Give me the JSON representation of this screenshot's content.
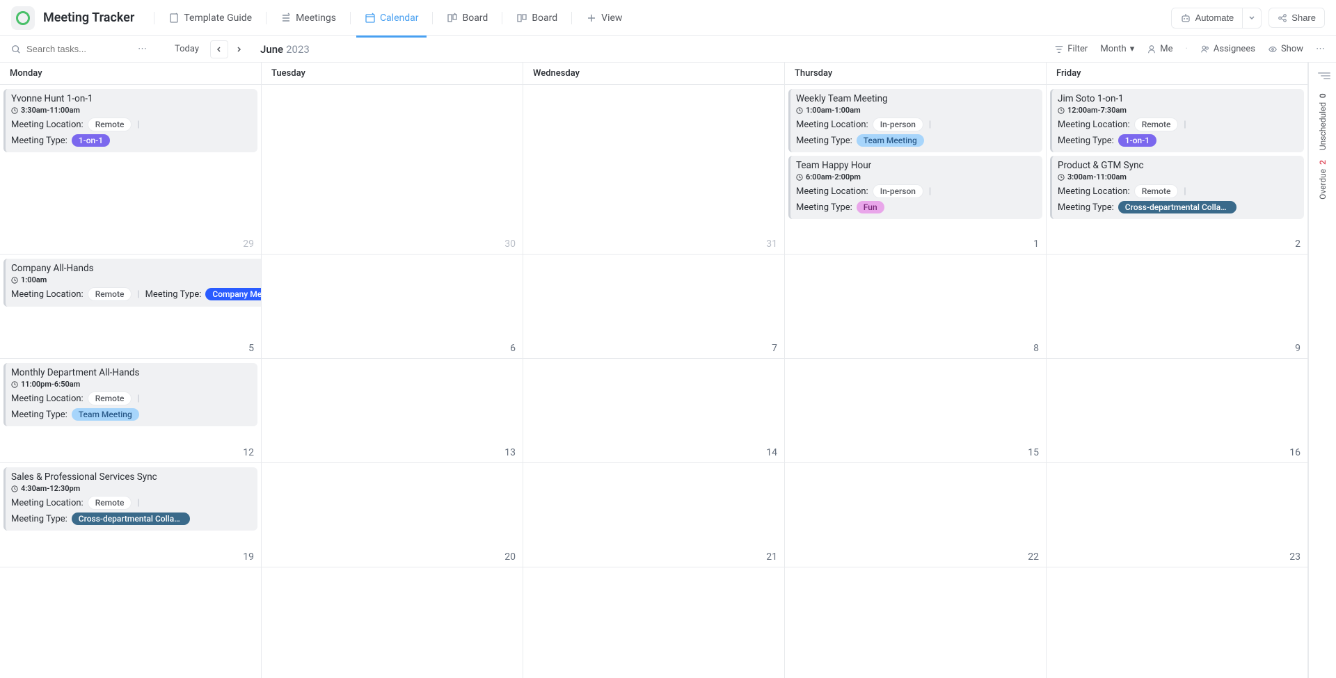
{
  "header": {
    "title": "Meeting Tracker",
    "tabs": [
      "Template Guide",
      "Meetings",
      "Calendar",
      "Board",
      "Board"
    ],
    "view": "View",
    "automate": "Automate",
    "share": "Share"
  },
  "controls": {
    "search_placeholder": "Search tasks...",
    "today": "Today",
    "month": "June",
    "year": "2023",
    "filter": "Filter",
    "view_mode": "Month",
    "me": "Me",
    "assignees": "Assignees",
    "show": "Show"
  },
  "day_headers": [
    "Monday",
    "Tuesday",
    "Wednesday",
    "Thursday",
    "Friday"
  ],
  "grid_days": [
    [
      {
        "n": "29",
        "muted": true
      },
      {
        "n": "30",
        "muted": true
      },
      {
        "n": "31",
        "muted": true
      },
      {
        "n": "1"
      },
      {
        "n": "2"
      }
    ],
    [
      {
        "n": "5"
      },
      {
        "n": "6"
      },
      {
        "n": "7"
      },
      {
        "n": "8"
      },
      {
        "n": "9"
      }
    ],
    [
      {
        "n": "12"
      },
      {
        "n": "13"
      },
      {
        "n": "14"
      },
      {
        "n": "15"
      },
      {
        "n": "16"
      }
    ],
    [
      {
        "n": "19"
      },
      {
        "n": "20"
      },
      {
        "n": "21"
      },
      {
        "n": "22"
      },
      {
        "n": "23"
      }
    ],
    [
      {
        "n": ""
      },
      {
        "n": ""
      },
      {
        "n": ""
      },
      {
        "n": ""
      },
      {
        "n": ""
      }
    ]
  ],
  "labels": {
    "location": "Meeting Location:",
    "type": "Meeting Type:"
  },
  "events": {
    "r0c0": [
      {
        "title": "Yvonne Hunt 1-on-1",
        "time": "3:30am-11:00am",
        "loc": "Remote",
        "loc_cls": "remote",
        "mtype": "1-on-1",
        "mtype_cls": "one"
      }
    ],
    "r0c3": [
      {
        "title": "Weekly Team Meeting",
        "time": "1:00am-1:00am",
        "loc": "In-person",
        "loc_cls": "inperson",
        "mtype": "Team Meeting",
        "mtype_cls": "team"
      },
      {
        "title": "Team Happy Hour",
        "time": "6:00am-2:00pm",
        "loc": "In-person",
        "loc_cls": "inperson",
        "mtype": "Fun",
        "mtype_cls": "fun"
      }
    ],
    "r0c4": [
      {
        "title": "Jim Soto 1-on-1",
        "time": "12:00am-7:30am",
        "loc": "Remote",
        "loc_cls": "remote",
        "mtype": "1-on-1",
        "mtype_cls": "one"
      },
      {
        "title": "Product & GTM Sync",
        "time": "3:00am-11:00am",
        "loc": "Remote",
        "loc_cls": "remote",
        "mtype": "Cross-departmental Collab…",
        "mtype_cls": "cross"
      }
    ],
    "r1c0": [
      {
        "title": "Company All-Hands",
        "time": "1:00am",
        "loc": "Remote",
        "loc_cls": "remote",
        "mtype": "Company Meeting",
        "mtype_cls": "company",
        "wide": true
      }
    ],
    "r2c0": [
      {
        "title": "Monthly Department All-Hands",
        "time": "11:00pm-6:50am",
        "loc": "Remote",
        "loc_cls": "remote",
        "mtype": "Team Meeting",
        "mtype_cls": "team"
      }
    ],
    "r3c0": [
      {
        "title": "Sales & Professional Services Sync",
        "time": "4:30am-12:30pm",
        "loc": "Remote",
        "loc_cls": "remote",
        "mtype": "Cross-departmental Collab…",
        "mtype_cls": "cross"
      }
    ]
  },
  "sidebar": {
    "unscheduled_label": "Unscheduled",
    "unscheduled_count": "0",
    "overdue_label": "Overdue",
    "overdue_count": "2"
  }
}
